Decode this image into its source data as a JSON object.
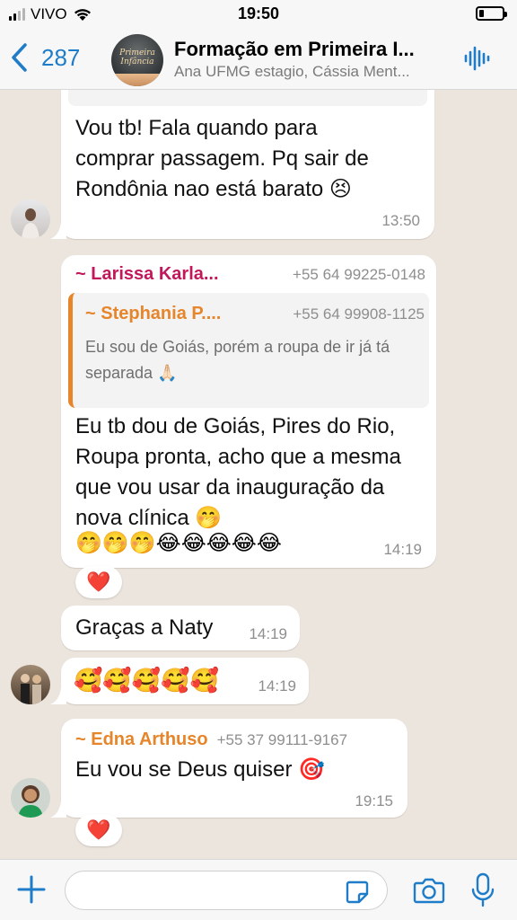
{
  "status_bar": {
    "carrier": "VIVO",
    "time": "19:50"
  },
  "header": {
    "back_count": "287",
    "group_name": "Formação em Primeira I...",
    "participants": "Ana UFMG estagio, Cássia Ment...",
    "avatar_text": "Primeira Infância"
  },
  "messages": [
    {
      "text": "Vou tb! Fala quando para comprar passagem. Pq sair de Rondônia nao está barato 😣",
      "time": "13:50"
    },
    {
      "sender": "~ Larissa Karla...",
      "phone": "+55 64 99225-0148",
      "quoted": {
        "sender": "~ Stephania P....",
        "phone": "+55 64 99908-1125",
        "text": "Eu sou de Goiás, porém a roupa de ir já tá separada 🙏🏻"
      },
      "text": "Eu tb dou de Goiás, Pires do Rio, Roupa pronta, acho que a mesma que vou usar da inauguração da nova clínica 🤭",
      "emojis": "🤭🤭🤭😂😂😂😂😂",
      "time": "14:19",
      "reaction": "❤️"
    },
    {
      "text": "Graças a Naty",
      "time": "14:19"
    },
    {
      "emojis": "🥰🥰🥰🥰🥰",
      "time": "14:19"
    },
    {
      "sender": "~ Edna Arthuso",
      "phone": "+55 37 99111-9167",
      "text": "Eu vou se Deus quiser 🎯",
      "time": "19:15",
      "reaction": "❤️"
    }
  ],
  "composer": {
    "placeholder": ""
  },
  "colors": {
    "accent": "#1f7cc9",
    "larissa": "#c2185b",
    "stephania": "#e6852a",
    "edna": "#e6852a",
    "chat_background": "#ece5dd"
  },
  "icons": [
    "back-chevron-icon",
    "wifi-icon",
    "battery-icon",
    "voice-waveform-icon",
    "plus-icon",
    "sticker-icon",
    "camera-icon",
    "microphone-icon",
    "heart-icon"
  ]
}
